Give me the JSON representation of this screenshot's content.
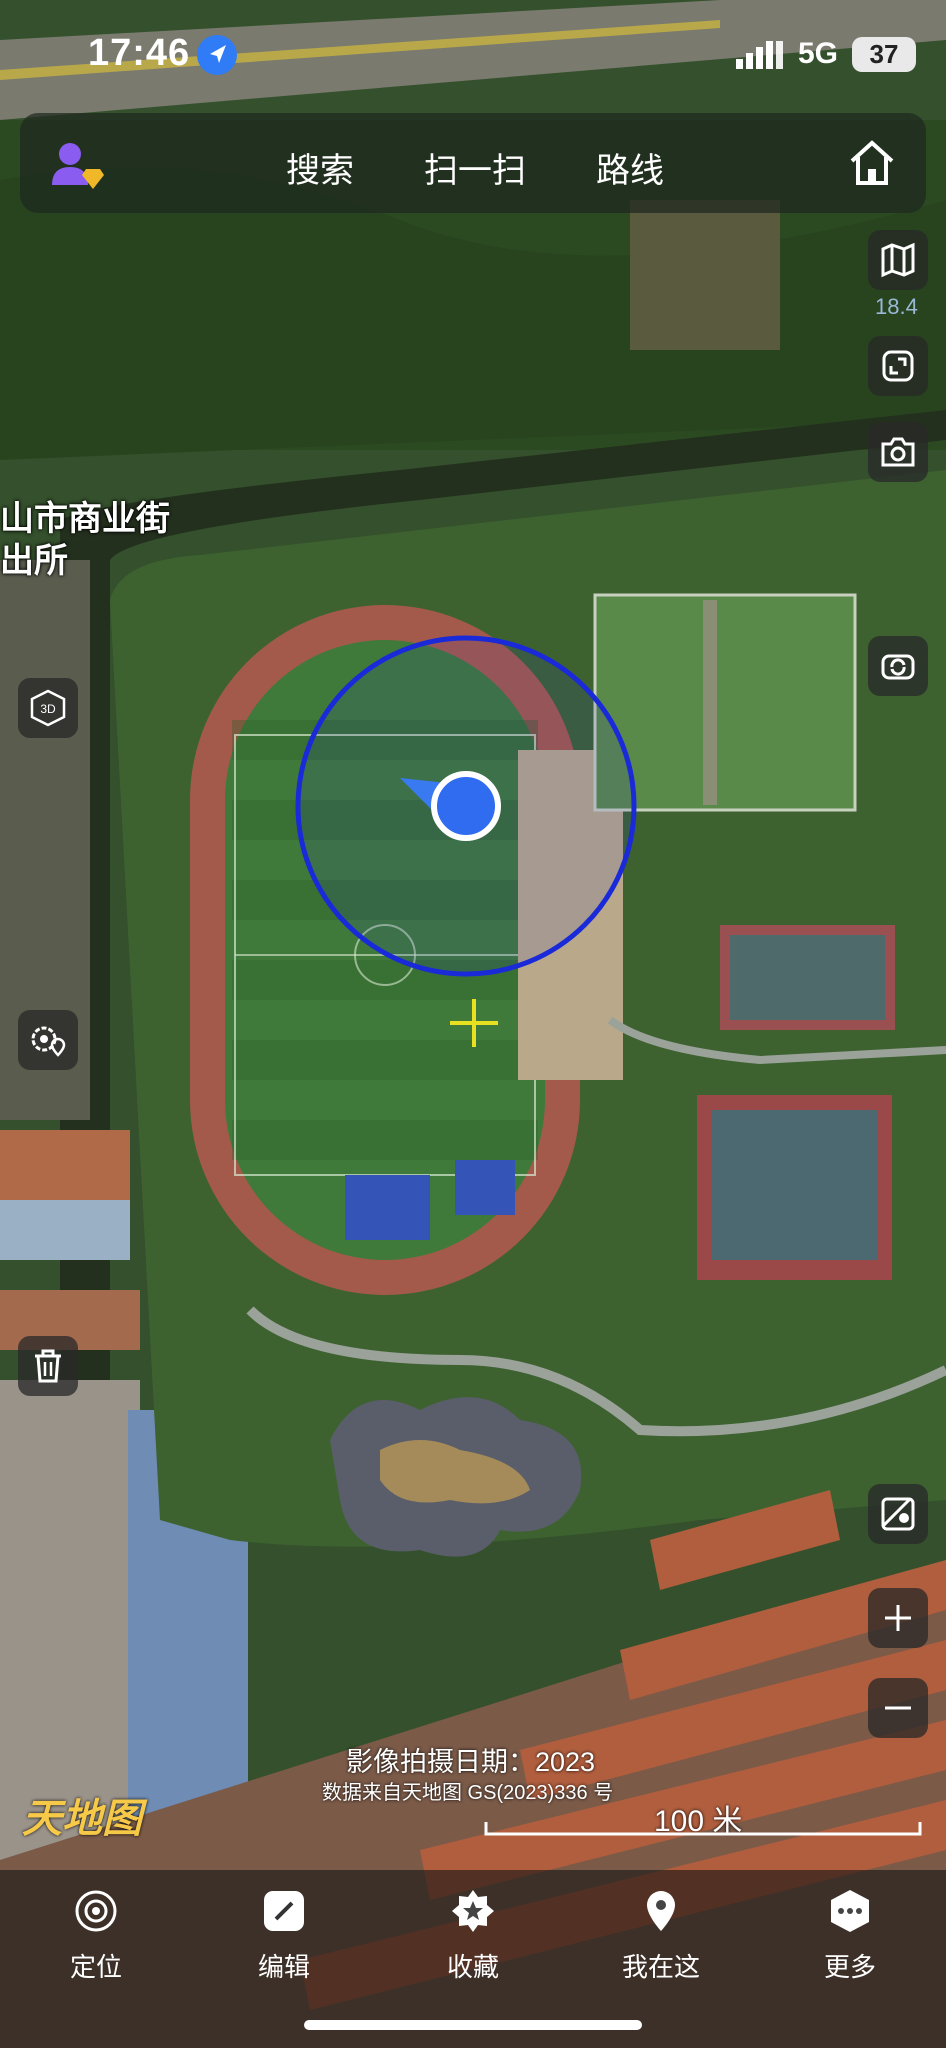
{
  "status_bar": {
    "time": "17:46",
    "network": "5G",
    "battery": "37"
  },
  "top_bar": {
    "tabs": [
      "搜索",
      "扫一扫",
      "路线"
    ]
  },
  "map_controls": {
    "zoom_level": "18.4"
  },
  "map_labels": {
    "place_line1": "山市商业街",
    "place_line2": "出所"
  },
  "map_info": {
    "imagery_date": "影像拍摄日期：2023",
    "data_source": "数据来自天地图 GS(2023)336 号",
    "scale": "100 米",
    "logo": "天地图"
  },
  "bottom_nav": [
    "定位",
    "编辑",
    "收藏",
    "我在这",
    "更多"
  ],
  "colors": {
    "location_blue": "#2f6cf0",
    "accuracy_ring": "#1a2ad8",
    "crosshair": "#e8e020"
  }
}
